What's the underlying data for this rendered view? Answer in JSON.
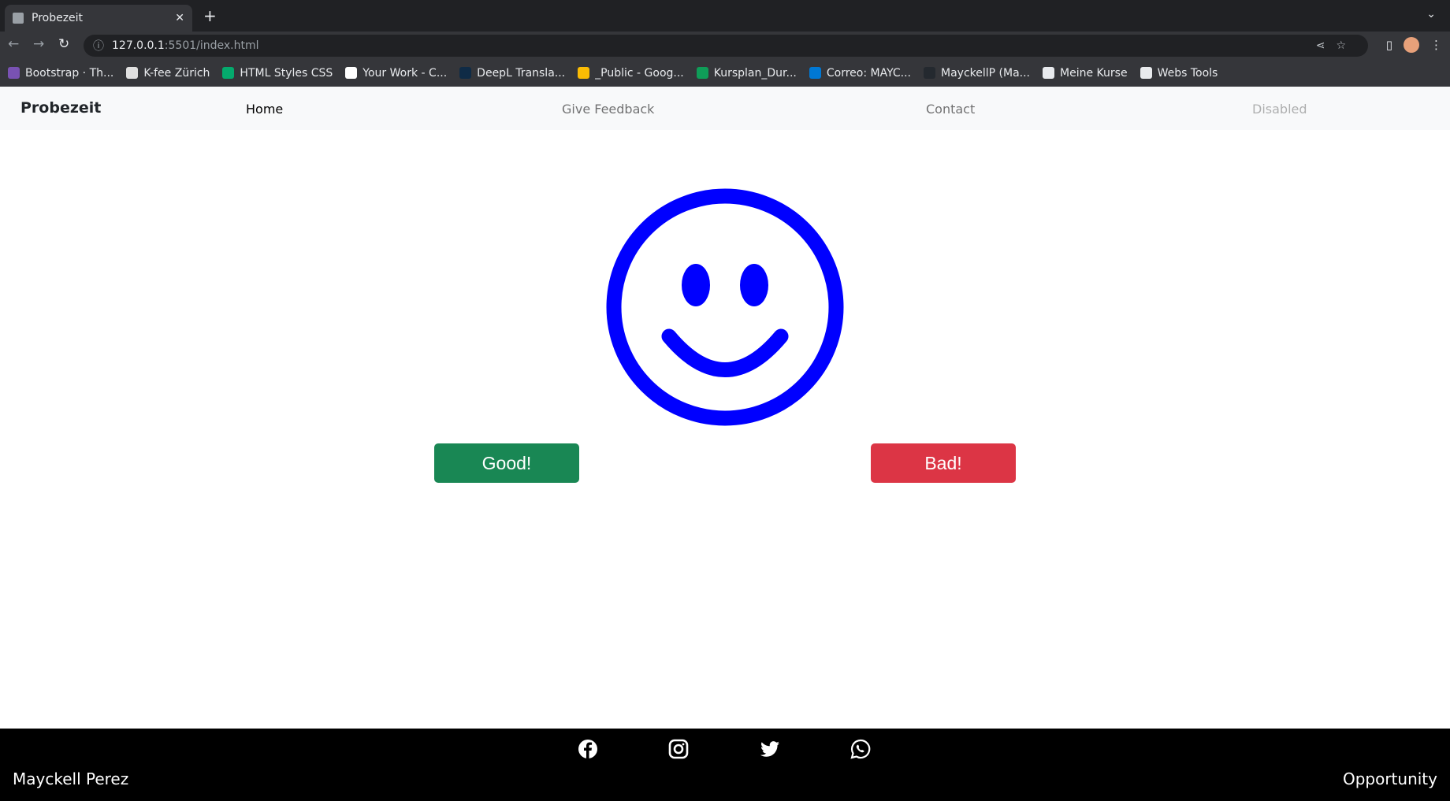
{
  "browser": {
    "tab_title": "Probezeit",
    "url_host": "127.0.0.1",
    "url_path": ":5501/index.html",
    "bookmarks": [
      {
        "label": "Bootstrap · Th...",
        "color": "#7952b3"
      },
      {
        "label": "K-fee Zürich",
        "color": "#e0e0e0"
      },
      {
        "label": "HTML Styles CSS",
        "color": "#04aa6d"
      },
      {
        "label": "Your Work - C...",
        "color": "#ffffff"
      },
      {
        "label": "DeepL Transla...",
        "color": "#0f2b46"
      },
      {
        "label": "_Public - Goog...",
        "color": "#fbbc04"
      },
      {
        "label": "Kursplan_Dur...",
        "color": "#0f9d58"
      },
      {
        "label": "Correo: MAYC...",
        "color": "#0078d4"
      },
      {
        "label": "MayckellP (Ma...",
        "color": "#24292f"
      },
      {
        "label": "Meine Kurse",
        "color": "#e8eaed"
      },
      {
        "label": "Webs Tools",
        "color": "#e8eaed"
      }
    ]
  },
  "navbar": {
    "brand": "Probezeit",
    "links": [
      "Home",
      "Give Feedback",
      "Contact",
      "Disabled"
    ]
  },
  "main": {
    "icon": "smiley-face-icon",
    "icon_color": "#0000ff",
    "good_label": "Good!",
    "bad_label": "Bad!",
    "good_color": "#198754",
    "bad_color": "#dc3545"
  },
  "footer": {
    "name": "Mayckell Perez",
    "right": "Opportunity",
    "social": [
      "facebook-icon",
      "instagram-icon",
      "twitter-icon",
      "whatsapp-icon"
    ]
  }
}
